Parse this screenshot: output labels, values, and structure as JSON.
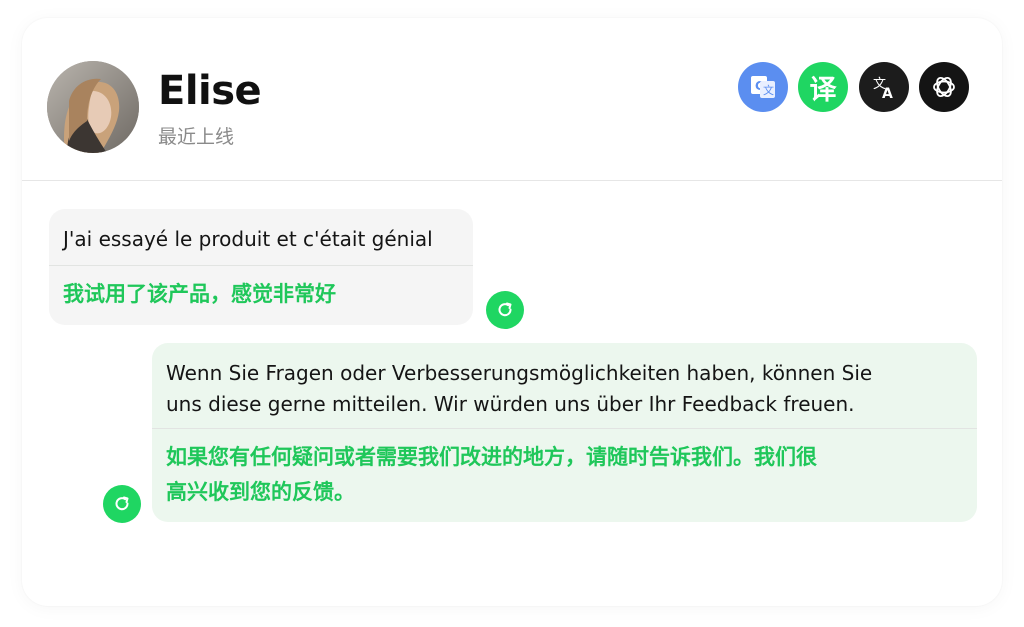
{
  "contact": {
    "name": "Elise",
    "status": "最近上线"
  },
  "toolbar": {
    "buttons": [
      {
        "icon": "google-translate-icon",
        "color": "#5b8ef0"
      },
      {
        "icon": "yi-translate-icon",
        "label": "译",
        "color": "#1fd662"
      },
      {
        "icon": "deepl-translate-icon",
        "color": "#1c1c1c"
      },
      {
        "icon": "openai-icon",
        "color": "#141414"
      }
    ]
  },
  "messages": [
    {
      "direction": "incoming",
      "text": "J'ai essayé le produit et c'était génial",
      "translation": "我试用了该产品，感觉非常好",
      "action_icon": "refresh-icon"
    },
    {
      "direction": "outgoing",
      "text_lines": [
        "Wenn Sie Fragen oder Verbesserungsmöglichkeiten haben, können Sie",
        "uns diese gerne mitteilen. Wir würden uns über Ihr Feedback freuen."
      ],
      "translation_lines": [
        "如果您有任何疑问或者需要我们改进的地方，请随时告诉我们。我们很",
        "高兴收到您的反馈。"
      ],
      "action_icon": "refresh-icon"
    }
  ],
  "colors": {
    "accent_green": "#1fd662",
    "translation_text": "#1fc75a",
    "incoming_bubble": "#f5f5f5",
    "outgoing_bubble": "#ecf7ee"
  }
}
